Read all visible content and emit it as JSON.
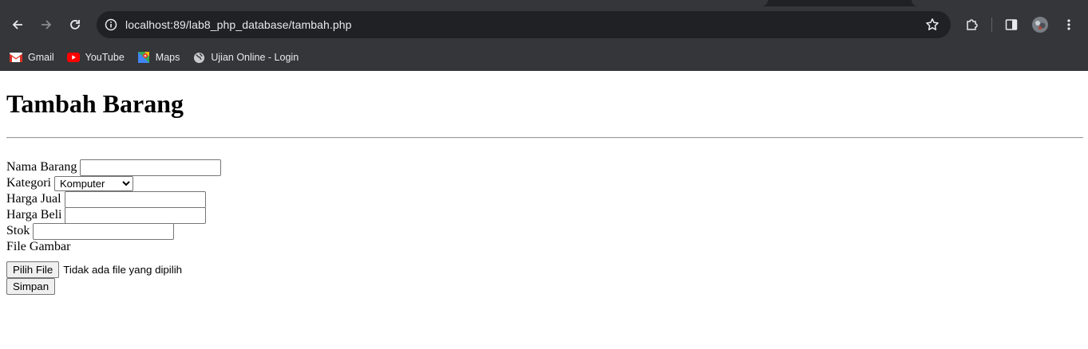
{
  "browser": {
    "url_host": "localhost",
    "url_rest": ":89/lab8_php_database/tambah.php",
    "bookmarks": [
      {
        "label": "Gmail",
        "icon": "gmail-icon"
      },
      {
        "label": "YouTube",
        "icon": "youtube-icon"
      },
      {
        "label": "Maps",
        "icon": "maps-icon"
      },
      {
        "label": "Ujian Online - Login",
        "icon": "globe-icon"
      }
    ]
  },
  "page": {
    "title": "Tambah Barang",
    "form": {
      "nama_label": "Nama Barang",
      "nama_value": "",
      "kategori_label": "Kategori",
      "kategori_selected": "Komputer",
      "harga_jual_label": "Harga Jual",
      "harga_jual_value": "",
      "harga_beli_label": "Harga Beli",
      "harga_beli_value": "",
      "stok_label": "Stok",
      "stok_value": "",
      "file_label": "File Gambar",
      "file_button": "Pilih File",
      "file_status": "Tidak ada file yang dipilih",
      "submit_label": "Simpan"
    }
  }
}
